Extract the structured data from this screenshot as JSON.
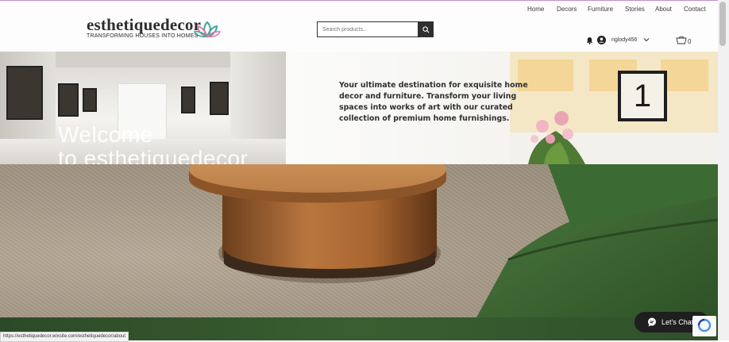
{
  "header": {
    "logo_name": "esthetiquedecor",
    "logo_tagline": "TRANSFORMING HOUSES INTO HOMES",
    "search_placeholder": "Search products...",
    "nav": [
      "Home",
      "Decors",
      "Furniture",
      "Stories",
      "About",
      "Contact"
    ],
    "username": "nglody456",
    "cart_count": "0"
  },
  "hero": {
    "welcome_line1": "Welcome",
    "welcome_line2": "to esthetiquedecor",
    "description": "Your ultimate destination for exquisite home decor and furniture. Transform your living spaces into works of art with our curated collection of premium home furnishings.",
    "frame_number": "1"
  },
  "chat": {
    "label": "Let's Chat!"
  },
  "status_bar": {
    "url": "https://esthetiquedecor.wixsite.com/esthetiquedecor/about"
  },
  "colors": {
    "logo_accent": "#3fa69a",
    "lotus_pink": "#e07ab0",
    "sofa_green": "#3f6b36",
    "footer_green": "#2f5029"
  }
}
